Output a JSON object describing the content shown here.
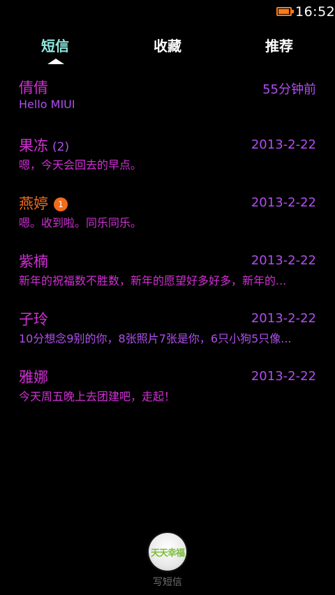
{
  "status_bar": {
    "time": "16:52",
    "battery_level": 0.85,
    "battery_color": "#ff7a1a"
  },
  "tabs": [
    {
      "label": "短信",
      "active": true
    },
    {
      "label": "收藏",
      "active": false
    },
    {
      "label": "推荐",
      "active": false
    }
  ],
  "colors": {
    "active_tab": "#8fe8e0",
    "accent_magenta": "#d22fd6",
    "accent_purple": "#b14ef0",
    "accent_orange": "#f36b1c"
  },
  "messages": [
    {
      "contact": "倩倩",
      "count": "",
      "badge": "",
      "time": "55分钟前",
      "preview": "Hello MIUI"
    },
    {
      "contact": "果冻",
      "count": "(2)",
      "badge": "",
      "time": "2013-2-22",
      "preview": "嗯，今天会回去的早点。"
    },
    {
      "contact": "燕婷",
      "count": "",
      "badge": "1",
      "time": "2013-2-22",
      "preview": "嗯。收到啦。同乐同乐。"
    },
    {
      "contact": "紫楠",
      "count": "",
      "badge": "",
      "time": "2013-2-22",
      "preview": "新年的祝福数不胜数，新年的愿望好多好多，新年的..."
    },
    {
      "contact": "子玲",
      "count": "",
      "badge": "",
      "time": "2013-2-22",
      "preview": "10分想念9别的你，8张照片7张是你，6只小狗5只像..."
    },
    {
      "contact": "雅娜",
      "count": "",
      "badge": "",
      "time": "2013-2-22",
      "preview": "今天周五晚上去团建吧，走起！"
    }
  ],
  "compose": {
    "icon_text": "天天幸福",
    "label": "写短信"
  }
}
